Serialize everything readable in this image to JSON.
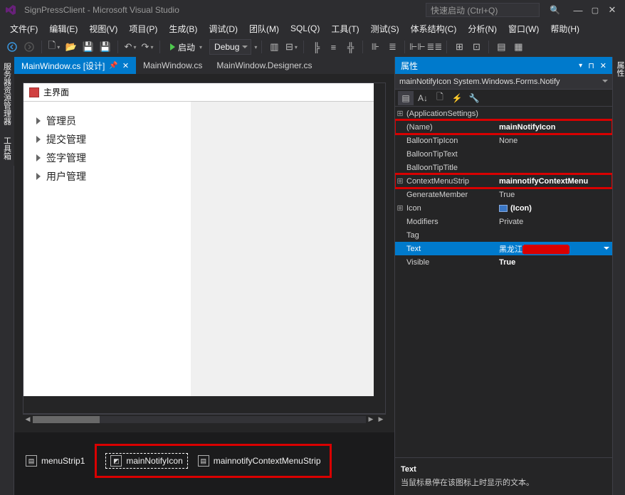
{
  "titlebar": {
    "title": "SignPressClient - Microsoft Visual Studio",
    "search_placeholder": "快速启动 (Ctrl+Q)"
  },
  "menubar": [
    "文件(F)",
    "编辑(E)",
    "视图(V)",
    "项目(P)",
    "生成(B)",
    "调试(D)",
    "团队(M)",
    "SQL(Q)",
    "工具(T)",
    "测试(S)",
    "体系结构(C)",
    "分析(N)",
    "窗口(W)",
    "帮助(H)"
  ],
  "toolbar": {
    "start_label": "启动",
    "config_label": "Debug"
  },
  "side_tabs": {
    "left1": "服务器资源管理器",
    "left2": "工具箱",
    "right1": "属性"
  },
  "doc_tabs": [
    {
      "label": "MainWindow.cs [设计]",
      "active": true,
      "pinned": true
    },
    {
      "label": "MainWindow.cs",
      "active": false
    },
    {
      "label": "MainWindow.Designer.cs",
      "active": false
    }
  ],
  "designer": {
    "form_title": "主界面",
    "tree": [
      "管理员",
      "提交管理",
      "签字管理",
      "用户管理"
    ]
  },
  "tray": {
    "items": [
      {
        "label": "menuStrip1"
      },
      {
        "label": "mainNotifyIcon",
        "selected": true
      },
      {
        "label": "mainnotifyContextMenuStrip"
      }
    ]
  },
  "properties": {
    "panel_title": "属性",
    "object_label": "mainNotifyIcon System.Windows.Forms.Notify",
    "rows": [
      {
        "exp": "⊞",
        "name": "(ApplicationSettings)",
        "val": ""
      },
      {
        "exp": "",
        "name": "(Name)",
        "val": "mainNotifyIcon",
        "bold": true,
        "highlight": true
      },
      {
        "exp": "",
        "name": "BalloonTipIcon",
        "val": "None"
      },
      {
        "exp": "",
        "name": "BalloonTipText",
        "val": ""
      },
      {
        "exp": "",
        "name": "BalloonTipTitle",
        "val": ""
      },
      {
        "exp": "⊞",
        "name": "ContextMenuStrip",
        "val": "mainnotifyContextMenu",
        "bold": true,
        "highlight": true
      },
      {
        "exp": "",
        "name": "GenerateMember",
        "val": "True"
      },
      {
        "exp": "⊞",
        "name": "Icon",
        "val": "(Icon)",
        "bold": true,
        "icon": true
      },
      {
        "exp": "",
        "name": "Modifiers",
        "val": "Private"
      },
      {
        "exp": "",
        "name": "Tag",
        "val": ""
      },
      {
        "exp": "",
        "name": "Text",
        "val": "黑龙江",
        "selected": true,
        "redact": true
      },
      {
        "exp": "",
        "name": "Visible",
        "val": "True",
        "bold": true
      }
    ],
    "desc_title": "Text",
    "desc_body": "当鼠标悬停在该图标上时显示的文本。"
  }
}
